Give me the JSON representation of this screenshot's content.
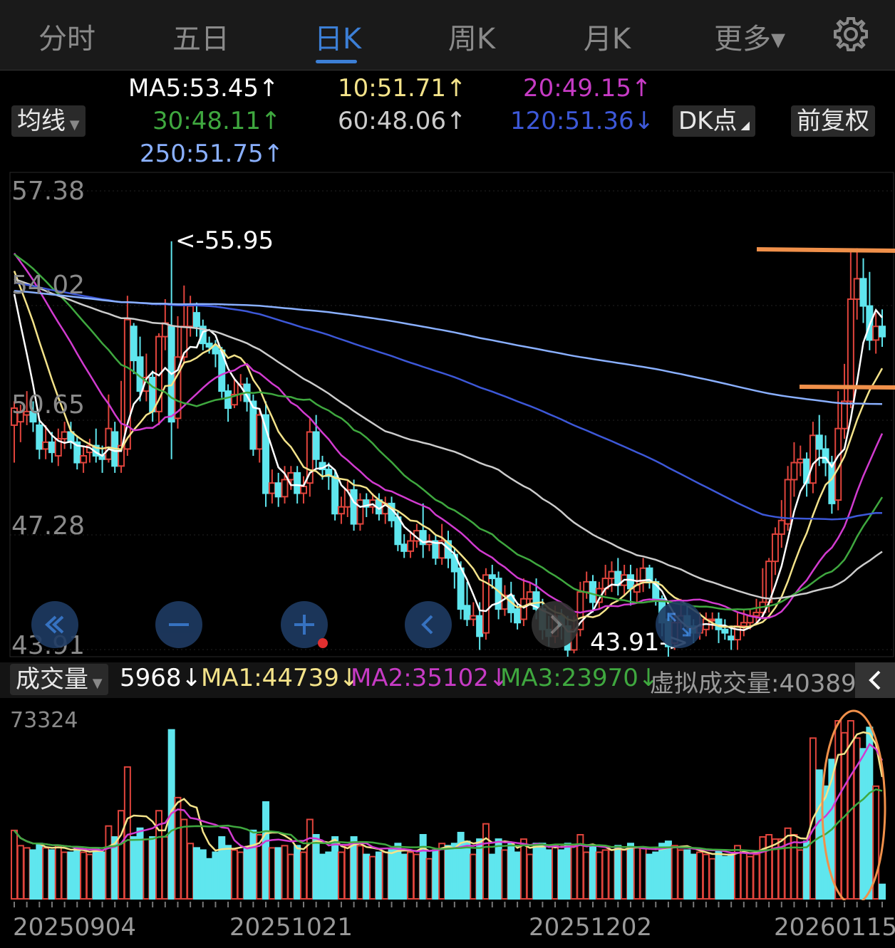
{
  "tabs": [
    {
      "label": "分时"
    },
    {
      "label": "五日"
    },
    {
      "label": "日K"
    },
    {
      "label": "周K"
    },
    {
      "label": "月K"
    },
    {
      "label": "更多▾"
    }
  ],
  "active_tab": "日K",
  "ma": {
    "ma5": "MA5:53.45↑",
    "ma10": "10:51.71↑",
    "ma20": "20:49.15↑",
    "ma30": "30:48.11↑",
    "ma60": "60:48.06↑",
    "ma120": "120:51.36↓",
    "ma250": "250:51.75↑"
  },
  "buttons": {
    "indicator": "均线",
    "dk": "DK点",
    "adjust": "前复权",
    "volume": "成交量"
  },
  "price_axis": [
    "57.38",
    "54.02",
    "50.65",
    "47.28",
    "43.91"
  ],
  "annotations": {
    "high": "<-55.95",
    "low": "43.91->"
  },
  "volume": {
    "value": "5968↓",
    "ma1": "MA1:44739↓",
    "ma2": "MA2:35102↓",
    "ma3": "MA3:23970↓",
    "virtual": "虚拟成交量:40389",
    "max": "73324"
  },
  "dates": [
    "20250904",
    "20251021",
    "20251202",
    "20260115"
  ],
  "colors": {
    "up": "#e0443c",
    "down": "#5fe6ee",
    "ma5": "#ffffff",
    "ma10": "#f4e38a",
    "ma20": "#d23bd0",
    "ma30": "#3fa83f",
    "ma60": "#cccccc",
    "ma120": "#3d58d8",
    "ma250": "#8ab0ff",
    "accent": "#3c7fd6",
    "mark": "#f0904a"
  },
  "chart_data": {
    "type": "candlestick",
    "ylim": [
      43.91,
      57.38
    ],
    "volume_max": 73324,
    "ohlc": [
      [
        50.5,
        51.0,
        49.4,
        51.2
      ],
      [
        50.6,
        50.9,
        50.0,
        51.1
      ],
      [
        50.8,
        50.9,
        50.5,
        51.5
      ],
      [
        50.9,
        50.6,
        50.3,
        51.2
      ],
      [
        50.5,
        49.8,
        49.5,
        50.7
      ],
      [
        49.8,
        50.0,
        49.5,
        50.5
      ],
      [
        50.0,
        49.7,
        49.4,
        50.3
      ],
      [
        49.6,
        50.1,
        49.3,
        50.4
      ],
      [
        50.1,
        50.3,
        49.8,
        50.6
      ],
      [
        50.3,
        50.0,
        49.8,
        50.6
      ],
      [
        50.0,
        49.4,
        49.2,
        50.2
      ],
      [
        49.4,
        49.6,
        49.1,
        49.9
      ],
      [
        49.7,
        49.9,
        49.4,
        50.1
      ],
      [
        49.9,
        49.6,
        49.4,
        50.4
      ],
      [
        49.6,
        49.5,
        49.1,
        49.9
      ],
      [
        49.5,
        50.4,
        49.4,
        51.4
      ],
      [
        50.3,
        49.3,
        49.1,
        50.6
      ],
      [
        49.3,
        49.9,
        49.1,
        51.8
      ],
      [
        49.8,
        53.6,
        49.6,
        54.3
      ],
      [
        53.4,
        52.4,
        52.0,
        53.5
      ],
      [
        52.5,
        51.5,
        51.2,
        53.1
      ],
      [
        51.5,
        51.9,
        51.2,
        52.6
      ],
      [
        51.9,
        50.9,
        50.6,
        52.1
      ],
      [
        50.9,
        53.1,
        50.5,
        53.2
      ],
      [
        53.1,
        53.5,
        52.7,
        54.2
      ],
      [
        53.4,
        50.6,
        49.5,
        55.9
      ],
      [
        50.7,
        52.5,
        50.4,
        53.7
      ],
      [
        52.5,
        53.4,
        52.3,
        54.6
      ],
      [
        53.4,
        54.0,
        53.1,
        54.3
      ],
      [
        53.8,
        53.4,
        53.1,
        54.1
      ],
      [
        53.4,
        52.9,
        52.7,
        53.6
      ],
      [
        52.9,
        52.8,
        52.6,
        53.1
      ],
      [
        52.8,
        52.6,
        52.2,
        53.0
      ],
      [
        52.7,
        51.5,
        51.3,
        52.8
      ],
      [
        51.5,
        51.0,
        50.6,
        51.7
      ],
      [
        51.1,
        51.4,
        51.0,
        51.9
      ],
      [
        51.4,
        51.7,
        51.2,
        52.0
      ],
      [
        51.7,
        51.2,
        50.9,
        51.9
      ],
      [
        51.2,
        49.8,
        49.6,
        51.4
      ],
      [
        49.8,
        50.8,
        49.4,
        51.0
      ],
      [
        50.8,
        48.5,
        48.1,
        51.2
      ],
      [
        48.5,
        48.8,
        48.2,
        49.2
      ],
      [
        48.8,
        48.4,
        48.1,
        49.1
      ],
      [
        48.4,
        48.9,
        48.2,
        49.3
      ],
      [
        48.9,
        49.1,
        48.6,
        49.3
      ],
      [
        49.1,
        48.5,
        48.2,
        49.3
      ],
      [
        48.5,
        48.7,
        48.2,
        49.0
      ],
      [
        48.8,
        50.3,
        48.4,
        50.7
      ],
      [
        50.3,
        49.5,
        49.2,
        50.8
      ],
      [
        49.4,
        49.2,
        48.9,
        49.6
      ],
      [
        49.2,
        49.0,
        48.6,
        49.4
      ],
      [
        49.0,
        47.9,
        47.7,
        49.2
      ],
      [
        47.9,
        48.1,
        47.6,
        48.4
      ],
      [
        48.1,
        48.6,
        47.8,
        48.9
      ],
      [
        48.6,
        47.6,
        47.4,
        48.9
      ],
      [
        47.6,
        48.3,
        47.4,
        48.5
      ],
      [
        48.3,
        48.1,
        47.8,
        48.5
      ],
      [
        48.1,
        48.3,
        47.9,
        48.5
      ],
      [
        48.3,
        47.9,
        47.7,
        48.5
      ],
      [
        47.9,
        48.2,
        47.6,
        48.4
      ],
      [
        48.2,
        47.7,
        47.5,
        48.4
      ],
      [
        47.8,
        47.0,
        46.8,
        48.0
      ],
      [
        47.0,
        46.8,
        46.6,
        47.3
      ],
      [
        46.8,
        47.1,
        46.6,
        47.4
      ],
      [
        47.1,
        47.4,
        46.9,
        47.6
      ],
      [
        47.4,
        47.0,
        46.6,
        48.2
      ],
      [
        47.0,
        47.1,
        46.8,
        47.3
      ],
      [
        47.1,
        46.6,
        46.4,
        47.3
      ],
      [
        46.6,
        47.1,
        46.4,
        47.6
      ],
      [
        47.1,
        46.6,
        46.3,
        47.4
      ],
      [
        46.7,
        46.2,
        45.7,
        46.9
      ],
      [
        46.3,
        45.1,
        44.8,
        46.5
      ],
      [
        45.2,
        44.8,
        44.6,
        45.9
      ],
      [
        44.8,
        44.9,
        44.6,
        45.3
      ],
      [
        44.9,
        44.3,
        43.9,
        45.3
      ],
      [
        44.4,
        46.1,
        44.2,
        46.3
      ],
      [
        46.1,
        46.0,
        45.7,
        46.4
      ],
      [
        46.0,
        45.1,
        44.8,
        46.2
      ],
      [
        45.1,
        45.5,
        44.9,
        45.8
      ],
      [
        45.5,
        45.0,
        44.7,
        45.9
      ],
      [
        45.1,
        44.7,
        44.5,
        45.3
      ],
      [
        44.8,
        45.4,
        44.6,
        46.0
      ],
      [
        45.4,
        45.6,
        45.2,
        45.9
      ],
      [
        45.6,
        45.1,
        44.8,
        46.0
      ],
      [
        45.1,
        44.5,
        44.2,
        45.4
      ],
      [
        44.5,
        44.3,
        44.0,
        44.9
      ],
      [
        44.3,
        44.9,
        44.1,
        45.2
      ],
      [
        44.9,
        44.6,
        44.2,
        45.1
      ],
      [
        44.6,
        43.9,
        43.7,
        44.9
      ],
      [
        43.9,
        44.5,
        43.8,
        44.9
      ],
      [
        44.5,
        45.6,
        44.3,
        45.9
      ],
      [
        45.6,
        45.9,
        45.4,
        46.2
      ],
      [
        45.9,
        45.3,
        45.0,
        46.1
      ],
      [
        45.3,
        45.7,
        45.1,
        45.9
      ],
      [
        45.7,
        46.0,
        45.5,
        46.4
      ],
      [
        46.0,
        46.2,
        45.6,
        46.5
      ],
      [
        46.2,
        45.8,
        45.5,
        46.6
      ],
      [
        45.8,
        46.1,
        45.5,
        46.4
      ],
      [
        46.1,
        45.7,
        45.2,
        46.4
      ],
      [
        45.6,
        45.8,
        45.3,
        46.3
      ],
      [
        45.9,
        46.3,
        45.6,
        46.6
      ],
      [
        46.3,
        45.9,
        45.7,
        46.4
      ],
      [
        45.9,
        45.4,
        45.2,
        46.0
      ],
      [
        45.4,
        44.7,
        44.3,
        45.5
      ],
      [
        44.8,
        44.0,
        43.7,
        45.0
      ],
      [
        44.1,
        44.7,
        43.9,
        45.0
      ],
      [
        44.7,
        44.9,
        44.5,
        45.4
      ],
      [
        44.9,
        44.6,
        44.3,
        45.2
      ],
      [
        44.6,
        44.4,
        44.1,
        44.8
      ],
      [
        44.4,
        44.6,
        44.2,
        45.0
      ],
      [
        44.5,
        44.8,
        44.3,
        45.0
      ],
      [
        44.8,
        44.8,
        44.5,
        45.0
      ],
      [
        44.8,
        44.5,
        44.1,
        45.0
      ],
      [
        44.5,
        44.4,
        44.2,
        44.8
      ],
      [
        44.3,
        44.2,
        43.9,
        44.6
      ],
      [
        44.2,
        44.6,
        43.9,
        45.0
      ],
      [
        44.6,
        44.7,
        44.3,
        45.1
      ],
      [
        44.7,
        44.9,
        44.5,
        45.1
      ],
      [
        44.9,
        45.0,
        44.7,
        45.4
      ],
      [
        45.0,
        45.3,
        44.8,
        46.3
      ],
      [
        45.3,
        46.5,
        45.0,
        46.6
      ],
      [
        46.5,
        47.3,
        46.1,
        47.5
      ],
      [
        47.3,
        47.7,
        46.9,
        48.3
      ],
      [
        47.6,
        48.9,
        47.4,
        49.3
      ],
      [
        48.9,
        49.4,
        48.4,
        50.0
      ],
      [
        49.4,
        49.5,
        49.0,
        49.9
      ],
      [
        49.5,
        48.8,
        48.4,
        49.7
      ],
      [
        48.8,
        50.2,
        48.5,
        50.6
      ],
      [
        50.2,
        49.8,
        49.3,
        50.8
      ],
      [
        49.8,
        49.4,
        49.0,
        50.2
      ],
      [
        49.4,
        48.2,
        47.9,
        49.6
      ],
      [
        48.3,
        50.4,
        48.0,
        51.5
      ],
      [
        50.4,
        51.2,
        50.1,
        52.3
      ],
      [
        51.2,
        54.2,
        51.0,
        55.6
      ],
      [
        54.2,
        54.8,
        53.6,
        55.7
      ],
      [
        54.8,
        54.0,
        53.5,
        55.4
      ],
      [
        54.0,
        53.0,
        52.7,
        55.0
      ],
      [
        53.0,
        53.4,
        52.6,
        53.8
      ],
      [
        53.4,
        53.1,
        52.8,
        53.9
      ]
    ]
  }
}
